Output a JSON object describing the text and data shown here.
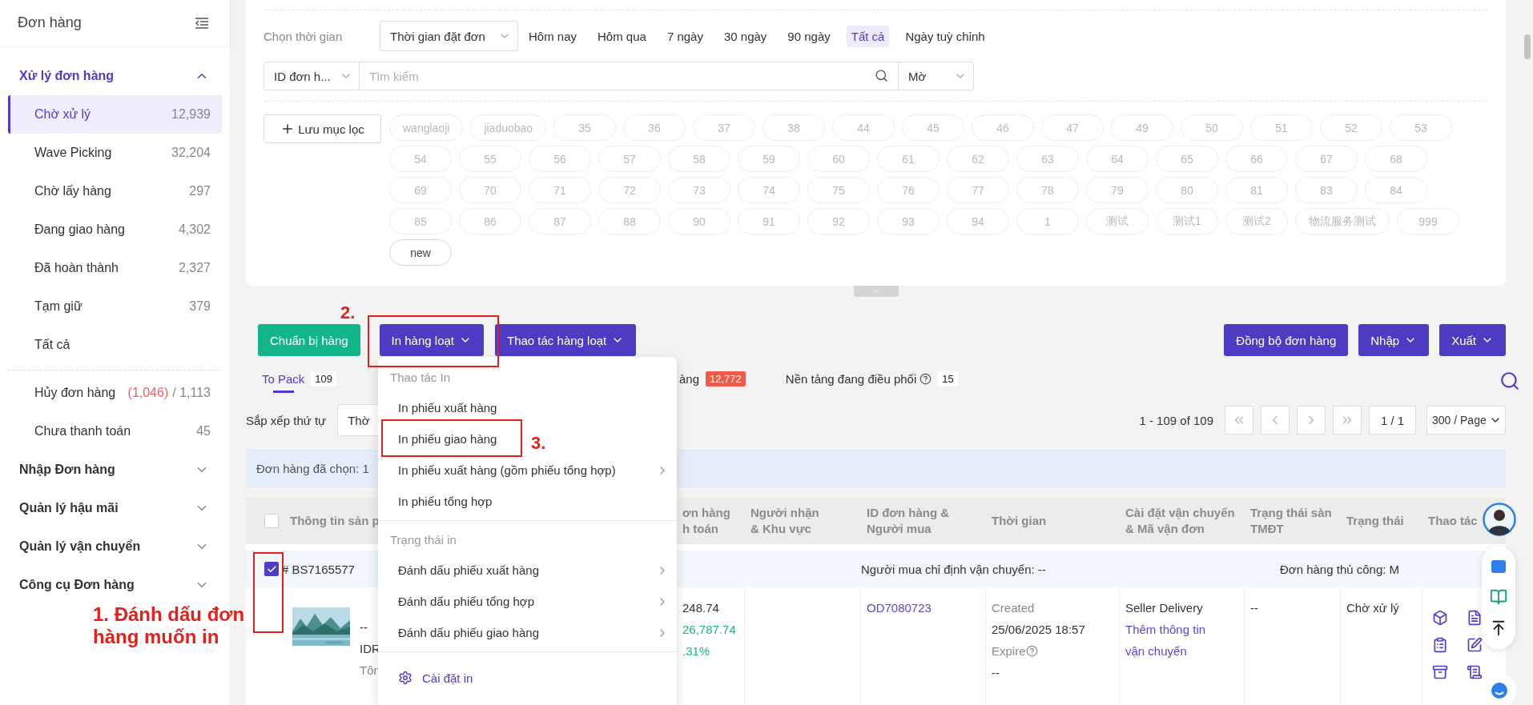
{
  "sidebar": {
    "title": "Đơn hàng",
    "groups": [
      {
        "label": "Xử lý đơn hàng",
        "expanded": true,
        "item_sets": [
          [
            {
              "label": "Chờ xử lý",
              "count": "12,939",
              "selected": true
            },
            {
              "label": "Wave Picking",
              "count": "32,204",
              "selected": false
            },
            {
              "label": "Chờ lấy hàng",
              "count": "297",
              "selected": false
            },
            {
              "label": "Đang giao hàng",
              "count": "4,302",
              "selected": false
            },
            {
              "label": "Đã hoàn thành",
              "count": "2,327",
              "selected": false
            },
            {
              "label": "Tạm giữ",
              "count": "379",
              "selected": false
            },
            {
              "label": "Tất cả",
              "selected": false
            }
          ],
          [
            {
              "label": "Hủy đơn hàng",
              "alert_count": "(1,046)",
              "count": "/ 1,113",
              "selected": false
            },
            {
              "label": "Chưa thanh toán",
              "count": "45",
              "selected": false
            }
          ]
        ]
      },
      {
        "label": "Nhập Đơn hàng",
        "expanded": false
      },
      {
        "label": "Quản lý hậu mãi",
        "expanded": false
      },
      {
        "label": "Quản lý vận chuyển",
        "expanded": false
      },
      {
        "label": "Công cụ Đơn hàng",
        "expanded": false
      }
    ]
  },
  "filter": {
    "time_label": "Chọn thời gian",
    "time_type": "Thời gian đặt đơn",
    "time_options": [
      {
        "label": "Hôm nay",
        "selected": false
      },
      {
        "label": "Hôm qua",
        "selected": false
      },
      {
        "label": "7 ngày",
        "selected": false
      },
      {
        "label": "30 ngày",
        "selected": false
      },
      {
        "label": "90 ngày",
        "selected": false
      },
      {
        "label": "Tất cả",
        "selected": true
      },
      {
        "label": "Ngày tuỳ chỉnh",
        "selected": false
      }
    ],
    "search_field": "ID đơn h...",
    "search_placeholder": "Tìm kiếm",
    "match_mode": "Mờ",
    "save_filter": "Lưu mục lọc",
    "tag_rows": [
      [
        "wanglaoji",
        "jiaduobao",
        "35",
        "36",
        "37",
        "38",
        "44",
        "45",
        "46",
        "47",
        "49",
        "50",
        "51",
        "52",
        "53"
      ],
      [
        "54",
        "55",
        "56",
        "57",
        "58",
        "59",
        "60",
        "61",
        "62",
        "63",
        "64",
        "65",
        "66",
        "67",
        "68"
      ],
      [
        "69",
        "70",
        "71",
        "72",
        "73",
        "74",
        "75",
        "76",
        "77",
        "78",
        "79",
        "80",
        "81",
        "83",
        "84"
      ],
      [
        "85",
        "86",
        "87",
        "88",
        "90",
        "91",
        "92",
        "93",
        "94",
        "1",
        "测试",
        "测试1",
        "测试2",
        "物流服务测试",
        "999"
      ],
      [
        "new"
      ]
    ]
  },
  "toolbar": {
    "left": [
      {
        "label": "Chuẩn bị hàng",
        "kind": "primary",
        "caret": false
      },
      {
        "label": "In hàng loạt",
        "kind": "action",
        "caret": true
      },
      {
        "label": "Thao tác hàng loạt",
        "kind": "action",
        "caret": true
      }
    ],
    "right": [
      {
        "label": "Đồng bộ đơn hàng",
        "kind": "action",
        "caret": false
      },
      {
        "label": "Nhập",
        "kind": "action",
        "caret": true
      },
      {
        "label": "Xuất",
        "kind": "action",
        "caret": true
      }
    ]
  },
  "tabs": [
    {
      "label": "To Pack",
      "count": "109",
      "kind": "plain",
      "help": false,
      "selected": true
    },
    {
      "label": "àng",
      "count": "12,772",
      "kind": "alert",
      "help": false,
      "selected": false
    },
    {
      "label": "Nền tảng đang điều phối",
      "count": "15",
      "kind": "plain",
      "help": true,
      "selected": false
    }
  ],
  "sort": {
    "label": "Sắp xếp thứ tự",
    "value": "Thờ"
  },
  "pagination": {
    "range": "1 - 109 of 109",
    "page": "1 / 1",
    "page_size": "300 / Page"
  },
  "selection_bar": "Đơn hàng đã chọn: 1",
  "table": {
    "header_checked": false,
    "columns": [
      "Thông tin sản p",
      "ơn hàng h toán",
      "Người nhận & Khu vực",
      "ID đơn hàng & Người mua",
      "Thời gian",
      "Cài đặt vận chuyển & Mã vận đơn",
      "Trạng thái sàn TMĐT",
      "Trạng thái",
      "Thao tác"
    ],
    "orders": [
      {
        "checked": true,
        "number": "# BS7165577",
        "shipping_note": "Người mua chỉ định vận chuyển: --",
        "manual_note": "Đơn hàng thủ công: M",
        "product": {
          "kind": "picture",
          "lines": [
            "--",
            "IDR",
            "Tôn"
          ]
        },
        "price": {
          "amount": "248.74",
          "total": "26,787.74",
          "rate": ".31%"
        },
        "order_id": "OD7080723",
        "time": {
          "created_label": "Created",
          "created": "25/06/2025 18:57",
          "expire_label": "Expire",
          "expire": "--"
        },
        "shipping": {
          "method": "Seller Delivery",
          "link": "Thêm thông tin vận chuyển"
        },
        "platform_status": "--",
        "status": "Chờ xử lý"
      }
    ]
  },
  "menu": {
    "sections": [
      {
        "title": "Thao tác In",
        "items": [
          {
            "label": "In phiếu xuất hàng",
            "submenu": false
          },
          {
            "label": "In phiếu giao hàng",
            "submenu": false
          },
          {
            "label": "In phiếu xuất hàng (gồm phiếu tổng hợp)",
            "submenu": true
          },
          {
            "label": "In phiếu tổng hợp",
            "submenu": false
          }
        ]
      },
      {
        "title": "Trạng thái in",
        "items": [
          {
            "label": "Đánh dấu phiếu xuất hàng",
            "submenu": true
          },
          {
            "label": "Đánh dấu phiếu tổng hợp",
            "submenu": true
          },
          {
            "label": "Đánh dấu phiếu giao hàng",
            "submenu": true
          }
        ]
      }
    ],
    "footer": "Cài đặt in"
  },
  "annotations": [
    "1. Đánh dấu đơn hàng muốn in",
    "2.",
    "3."
  ]
}
